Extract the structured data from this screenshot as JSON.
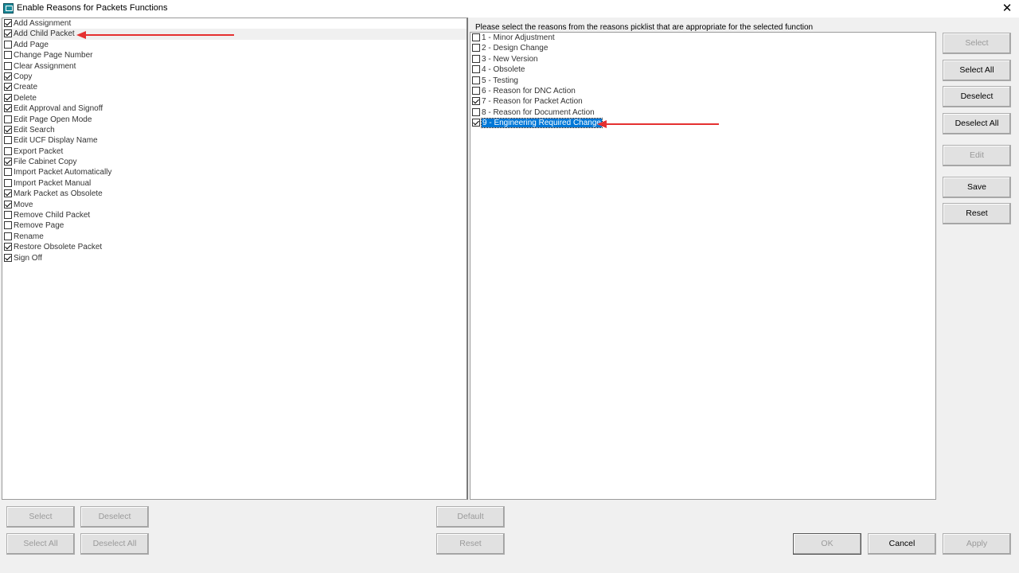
{
  "window": {
    "title": "Enable Reasons for Packets Functions"
  },
  "instruction": "Please select the reasons from the reasons picklist that are appropriate for the selected function",
  "functions": [
    {
      "label": "Add Assignment",
      "checked": true
    },
    {
      "label": "Add Child Packet",
      "checked": true,
      "focused": true
    },
    {
      "label": "Add Page",
      "checked": false
    },
    {
      "label": "Change Page Number",
      "checked": false
    },
    {
      "label": "Clear Assignment",
      "checked": false
    },
    {
      "label": "Copy",
      "checked": true
    },
    {
      "label": "Create",
      "checked": true
    },
    {
      "label": "Delete",
      "checked": true
    },
    {
      "label": "Edit Approval and Signoff",
      "checked": true
    },
    {
      "label": "Edit Page Open Mode",
      "checked": false
    },
    {
      "label": "Edit Search",
      "checked": true
    },
    {
      "label": "Edit UCF Display Name",
      "checked": false
    },
    {
      "label": "Export Packet",
      "checked": false
    },
    {
      "label": "File Cabinet Copy",
      "checked": true
    },
    {
      "label": "Import Packet Automatically",
      "checked": false
    },
    {
      "label": "Import Packet Manual",
      "checked": false
    },
    {
      "label": "Mark Packet as Obsolete",
      "checked": true
    },
    {
      "label": "Move",
      "checked": true
    },
    {
      "label": "Remove Child Packet",
      "checked": false
    },
    {
      "label": "Remove Page",
      "checked": false
    },
    {
      "label": "Rename",
      "checked": false
    },
    {
      "label": "Restore Obsolete Packet",
      "checked": true
    },
    {
      "label": "Sign Off",
      "checked": true
    }
  ],
  "reasons": [
    {
      "label": "1 - Minor Adjustment",
      "checked": false
    },
    {
      "label": "2 - Design Change",
      "checked": false
    },
    {
      "label": "3 - New Version",
      "checked": false
    },
    {
      "label": "4 - Obsolete",
      "checked": false
    },
    {
      "label": "5 - Testing",
      "checked": false
    },
    {
      "label": "6 - Reason for DNC Action",
      "checked": false
    },
    {
      "label": "7 - Reason for Packet Action",
      "checked": true
    },
    {
      "label": "8 - Reason for Document Action",
      "checked": false
    },
    {
      "label": "9 - Engineering Required Change",
      "checked": true,
      "selected": true
    }
  ],
  "right_buttons": {
    "select": "Select",
    "select_all": "Select All",
    "deselect": "Deselect",
    "deselect_all": "Deselect All",
    "edit": "Edit",
    "save": "Save",
    "reset": "Reset"
  },
  "bottom_buttons": {
    "select": "Select",
    "deselect": "Deselect",
    "select_all": "Select All",
    "deselect_all": "Deselect All",
    "default": "Default",
    "reset": "Reset",
    "ok": "OK",
    "cancel": "Cancel",
    "apply": "Apply"
  },
  "colors": {
    "annotation_arrow": "#e53030",
    "selection": "#0078d7"
  }
}
